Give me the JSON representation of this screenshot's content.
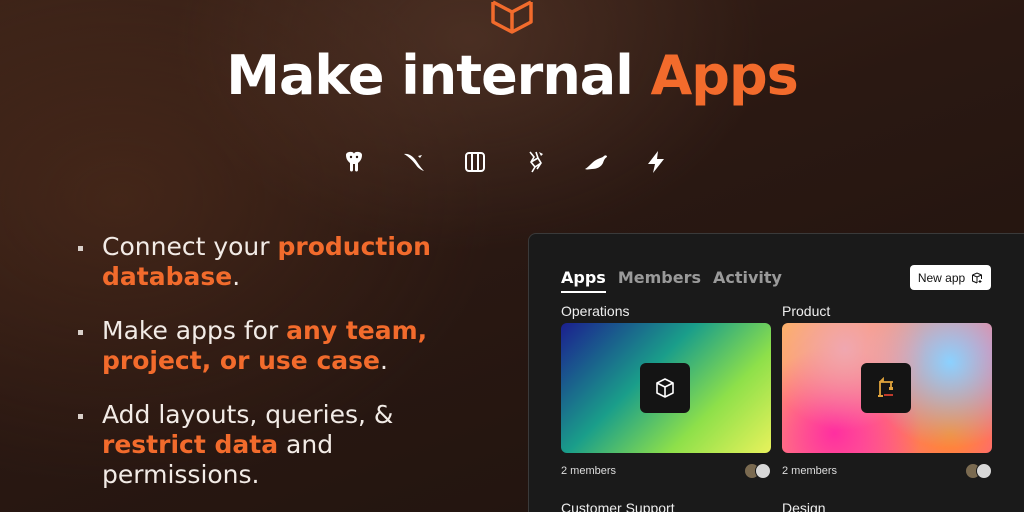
{
  "brand": {
    "accent": "#f26b2c",
    "logo_icon": "cube-outline-icon"
  },
  "headline": {
    "main": "Make internal ",
    "accent": "Apps"
  },
  "integrations": [
    "postgres-icon",
    "mysql-icon",
    "sql-server-icon",
    "hadoop-hive-icon",
    "mariadb-icon",
    "bolt-icon"
  ],
  "bullets": [
    {
      "pre": "Connect your ",
      "hl": "production database",
      "post": "."
    },
    {
      "pre": "Make apps for ",
      "hl": "any team, project, or use case",
      "post": "."
    },
    {
      "pre": "Add layouts, queries, & ",
      "hl": "restrict data",
      "post": " and permissions."
    }
  ],
  "panel": {
    "tabs": [
      {
        "label": "Apps",
        "active": true
      },
      {
        "label": "Members",
        "active": false
      },
      {
        "label": "Activity",
        "active": false
      }
    ],
    "new_app_label": "New app",
    "cards": [
      {
        "title": "Operations",
        "members": "2 members",
        "icon": "cube-icon"
      },
      {
        "title": "Product",
        "members": "2 members",
        "icon": "crane-icon"
      },
      {
        "title": "Customer Support"
      },
      {
        "title": "Design"
      }
    ]
  }
}
